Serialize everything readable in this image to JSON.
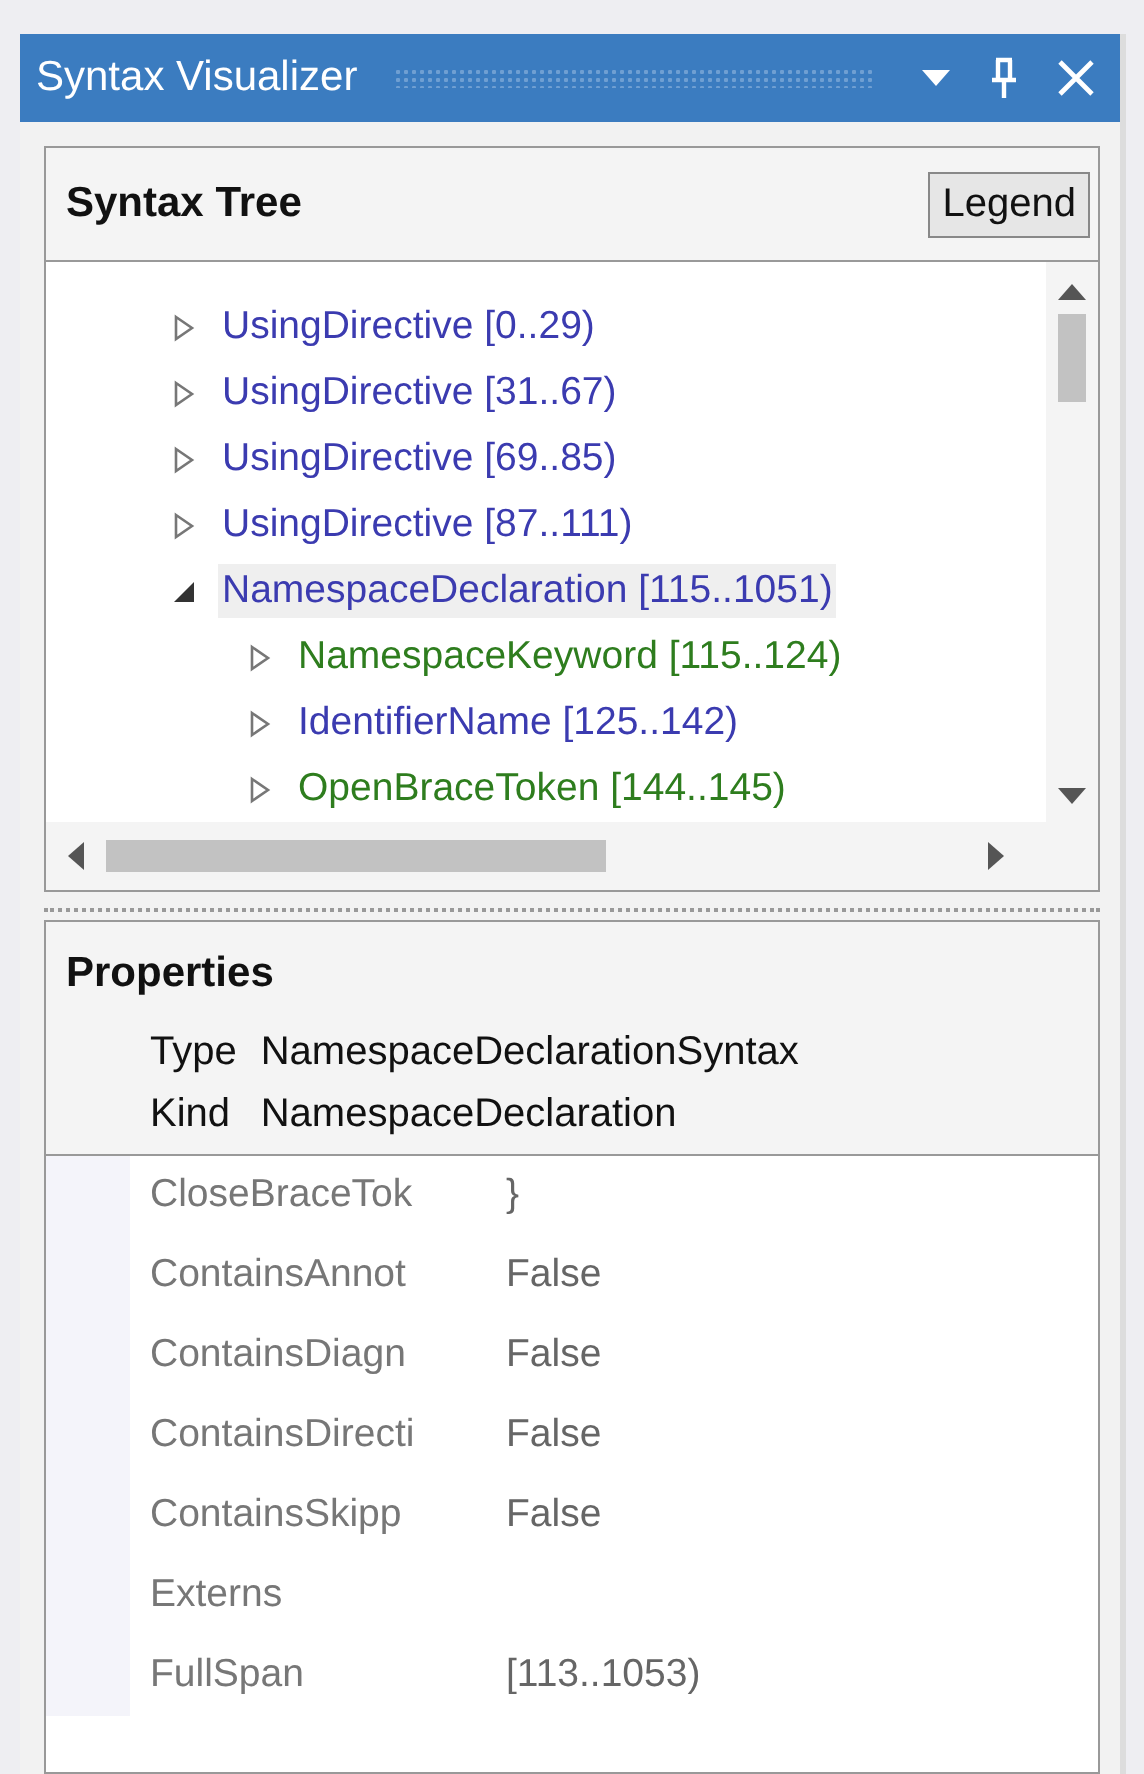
{
  "window": {
    "title": "Syntax Visualizer"
  },
  "syntax_tree": {
    "title": "Syntax Tree",
    "legend_button": "Legend",
    "items": [
      {
        "label": "UsingDirective [0..29)",
        "kind": "node",
        "expanded": false,
        "selected": false
      },
      {
        "label": "UsingDirective [31..67)",
        "kind": "node",
        "expanded": false,
        "selected": false
      },
      {
        "label": "UsingDirective [69..85)",
        "kind": "node",
        "expanded": false,
        "selected": false
      },
      {
        "label": "UsingDirective [87..111)",
        "kind": "node",
        "expanded": false,
        "selected": false
      },
      {
        "label": "NamespaceDeclaration [115..1051)",
        "kind": "node",
        "expanded": true,
        "selected": true,
        "children": [
          {
            "label": "NamespaceKeyword [115..124)",
            "kind": "token",
            "expanded": false,
            "selected": false
          },
          {
            "label": "IdentifierName [125..142)",
            "kind": "node",
            "expanded": false,
            "selected": false
          },
          {
            "label": "OpenBraceToken [144..145)",
            "kind": "token",
            "expanded": false,
            "selected": false
          }
        ]
      }
    ]
  },
  "properties": {
    "title": "Properties",
    "type_label": "Type",
    "type_value": "NamespaceDeclarationSyntax",
    "kind_label": "Kind",
    "kind_value": "NamespaceDeclaration",
    "rows": [
      {
        "name": "CloseBraceTok",
        "value": "}"
      },
      {
        "name": "ContainsAnnot",
        "value": "False"
      },
      {
        "name": "ContainsDiagn",
        "value": "False"
      },
      {
        "name": "ContainsDirecti",
        "value": "False"
      },
      {
        "name": "ContainsSkipp",
        "value": "False"
      },
      {
        "name": "Externs"
      },
      {
        "name": "FullSpan",
        "value": "[113..1053)"
      }
    ]
  }
}
